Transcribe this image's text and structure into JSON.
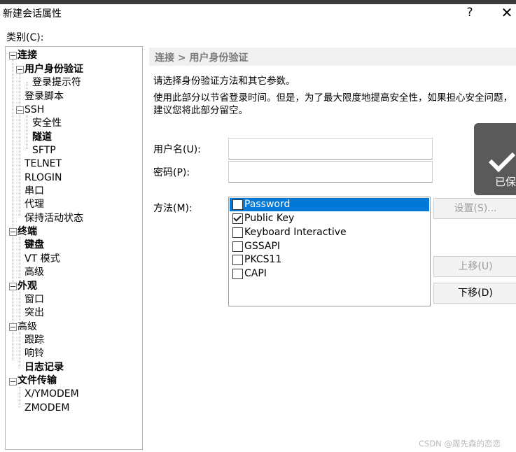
{
  "window": {
    "title": "新建会话属性",
    "help_label": "?",
    "close_label": "✕"
  },
  "category_label": "类别(C):",
  "tree": [
    {
      "label": "连接",
      "bold": true
    },
    {
      "label": "用户身份验证",
      "bold": true
    },
    {
      "label": "登录提示符",
      "bold": false
    },
    {
      "label": "登录脚本",
      "bold": false
    },
    {
      "label": "SSH",
      "bold": false
    },
    {
      "label": "安全性",
      "bold": false
    },
    {
      "label": "隧道",
      "bold": true
    },
    {
      "label": "SFTP",
      "bold": false
    },
    {
      "label": "TELNET",
      "bold": false
    },
    {
      "label": "RLOGIN",
      "bold": false
    },
    {
      "label": "串口",
      "bold": false
    },
    {
      "label": "代理",
      "bold": false
    },
    {
      "label": "保持活动状态",
      "bold": false
    },
    {
      "label": "终端",
      "bold": true
    },
    {
      "label": "键盘",
      "bold": true
    },
    {
      "label": "VT 模式",
      "bold": false
    },
    {
      "label": "高级",
      "bold": false
    },
    {
      "label": "外观",
      "bold": true
    },
    {
      "label": "窗口",
      "bold": false
    },
    {
      "label": "突出",
      "bold": false
    },
    {
      "label": "高级",
      "bold": false
    },
    {
      "label": "跟踪",
      "bold": false
    },
    {
      "label": "响铃",
      "bold": false
    },
    {
      "label": "日志记录",
      "bold": true
    },
    {
      "label": "文件传输",
      "bold": true
    },
    {
      "label": "X/YMODEM",
      "bold": false
    },
    {
      "label": "ZMODEM",
      "bold": false
    }
  ],
  "breadcrumb": "连接 > 用户身份验证",
  "description": {
    "line1": "请选择身份验证方法和其它参数。",
    "line2": "使用此部分以节省登录时间。但是，为了最大限度地提高安全性，如果担心安全问题，",
    "line3": "建议您将此部分留空。"
  },
  "form": {
    "username_label": "用户名(U):",
    "username_value": "",
    "password_label": "密码(P):",
    "password_value": "",
    "method_label": "方法(M):"
  },
  "methods": [
    {
      "label": "Password",
      "checked": false,
      "selected": true
    },
    {
      "label": "Public Key",
      "checked": true,
      "selected": false
    },
    {
      "label": "Keyboard Interactive",
      "checked": false,
      "selected": false
    },
    {
      "label": "GSSAPI",
      "checked": false,
      "selected": false
    },
    {
      "label": "PKCS11",
      "checked": false,
      "selected": false
    },
    {
      "label": "CAPI",
      "checked": false,
      "selected": false
    }
  ],
  "buttons": {
    "settings": "设置(S)...",
    "move_up": "上移(U)",
    "move_down": "下移(D)"
  },
  "toast": {
    "text": "已保"
  },
  "watermark": "CSDN @周先森的恋恋"
}
